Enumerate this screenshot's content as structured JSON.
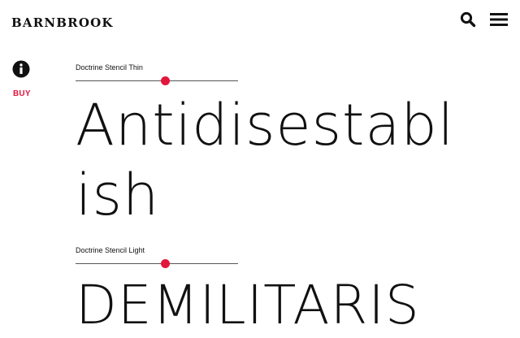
{
  "header": {
    "logo": "BARNBROOK",
    "search_icon": "search-icon",
    "menu_icon": "hamburger-menu-icon"
  },
  "sidebar": {
    "info_icon": "info-icon",
    "buy_label": "BUY"
  },
  "specimens": [
    {
      "label": "Doctrine Stencil Thin",
      "slider_value": 0.55,
      "sample_text": "Antidisestablish"
    },
    {
      "label": "Doctrine Stencil Light",
      "slider_value": 0.55,
      "sample_text": "DEMILITARIS"
    }
  ],
  "colors": {
    "accent": "#e3163c",
    "text": "#111111",
    "background": "#ffffff"
  }
}
